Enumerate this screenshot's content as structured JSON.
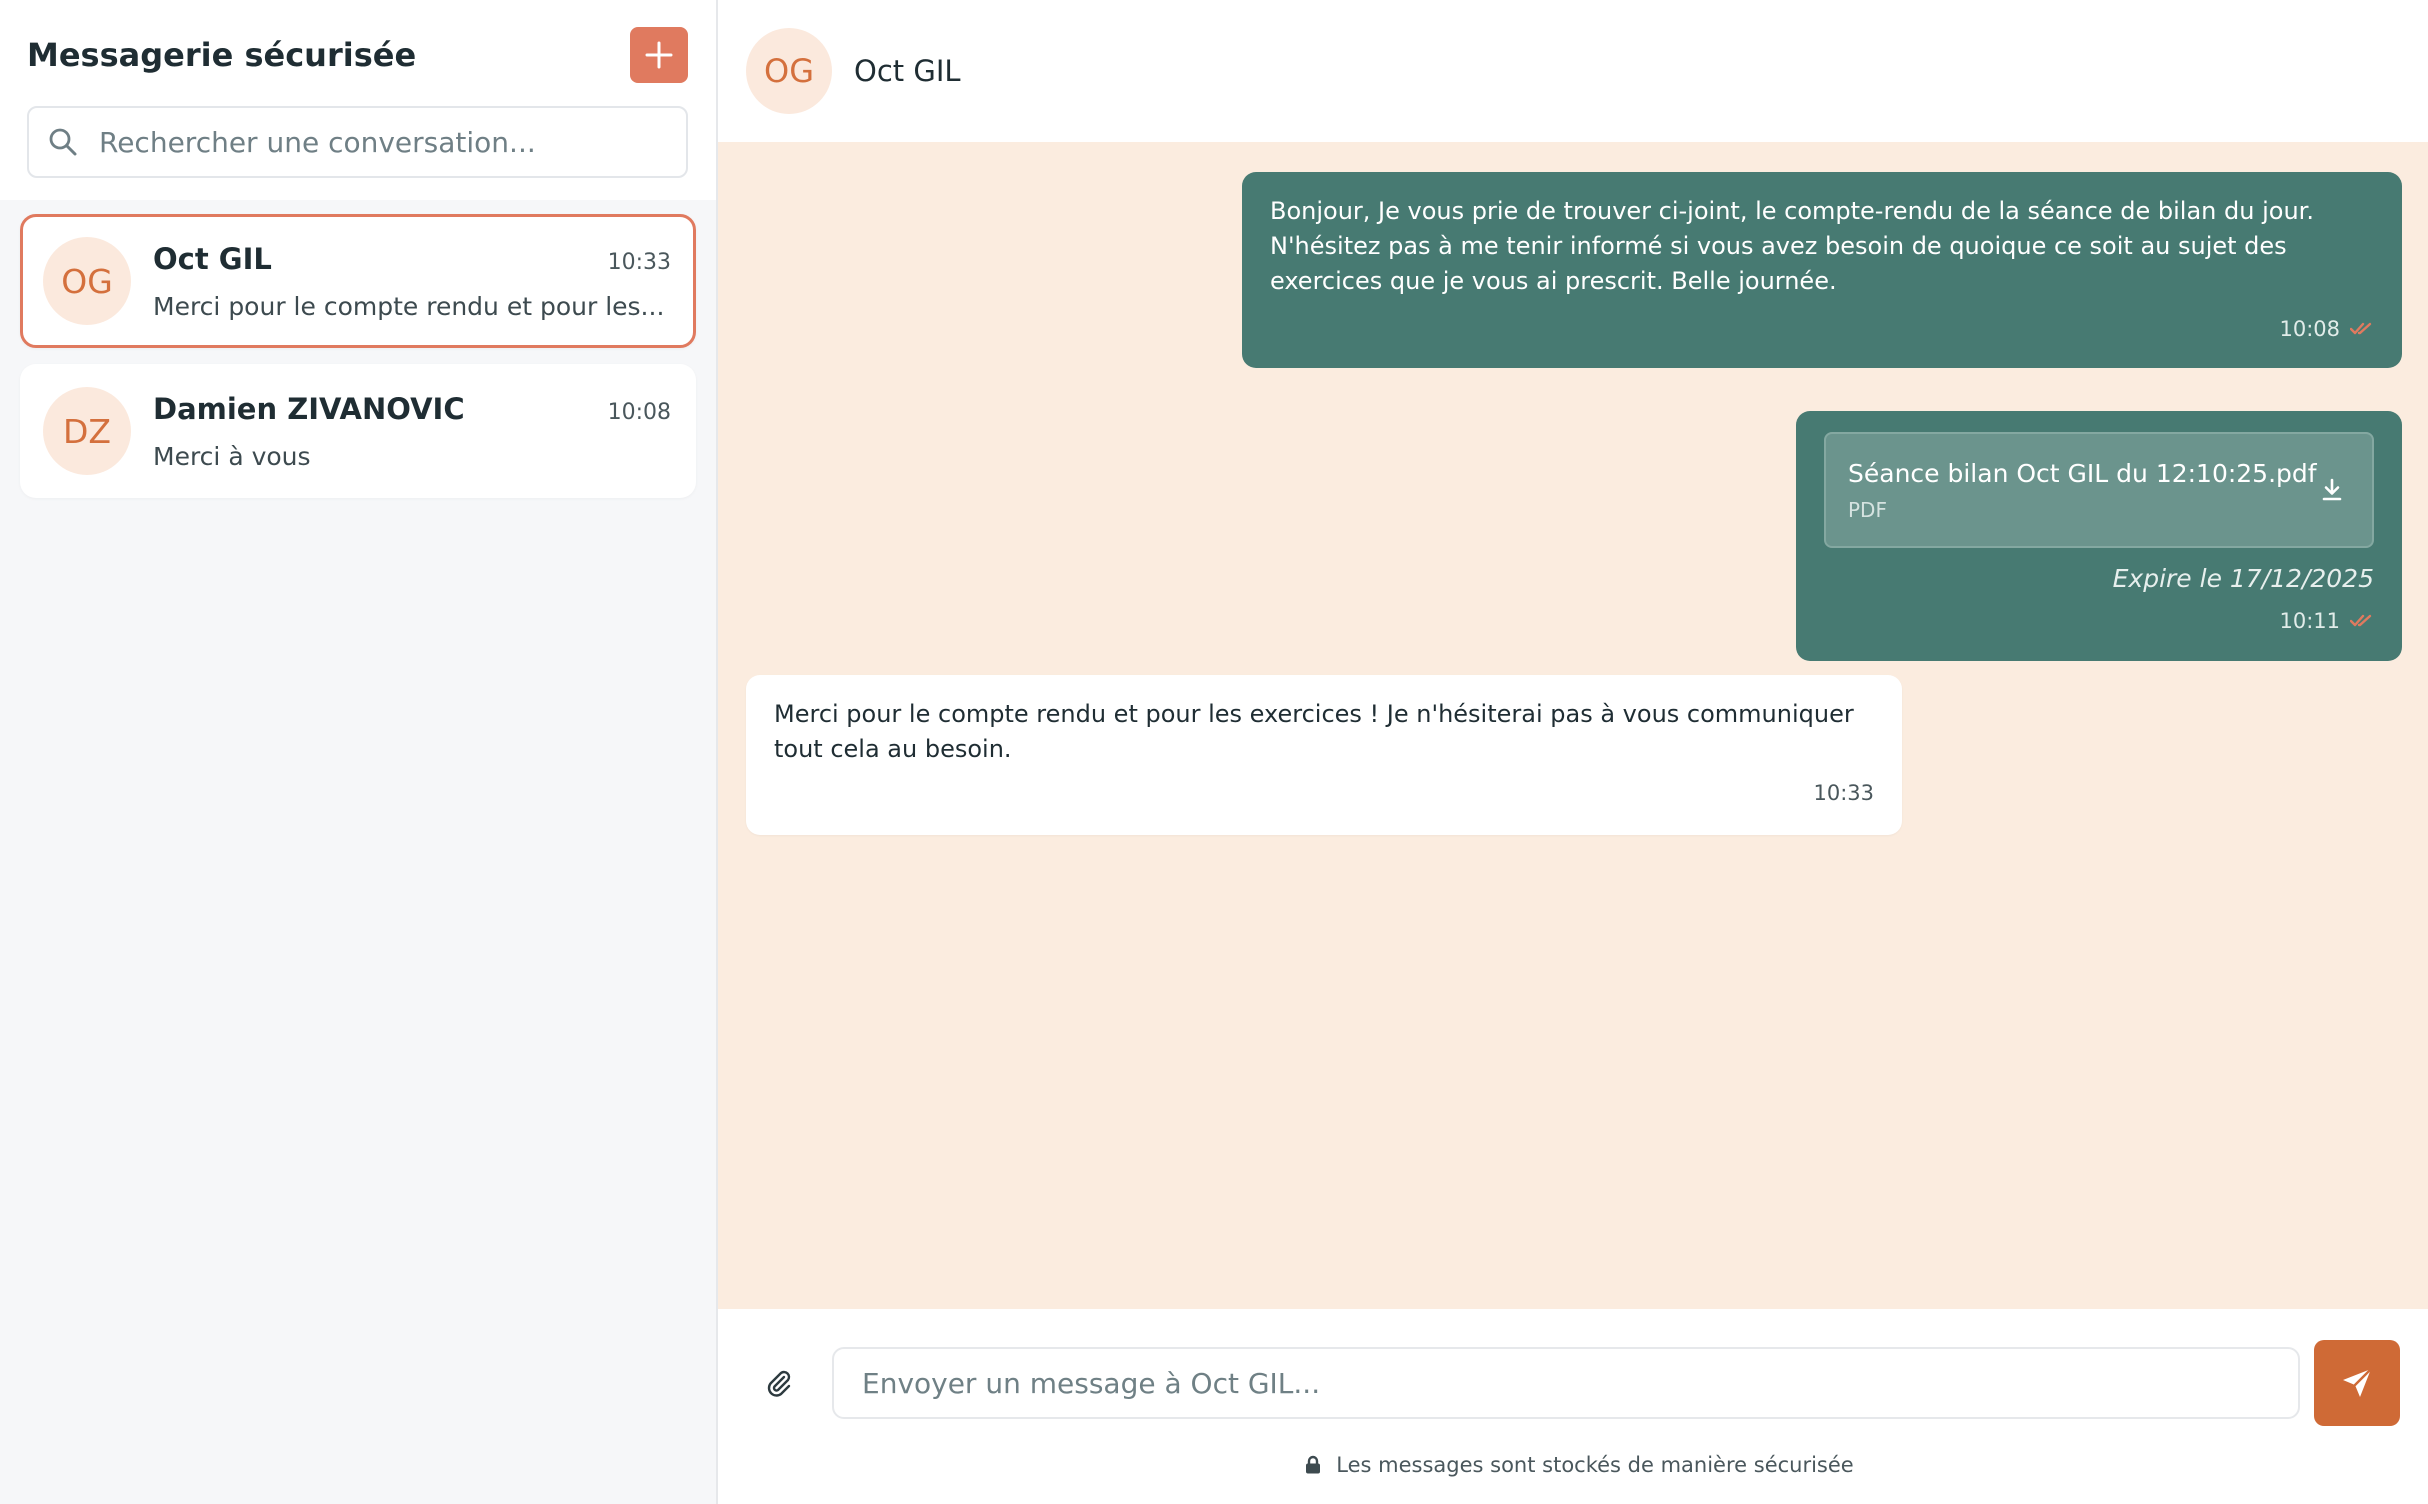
{
  "sidebar": {
    "title": "Messagerie sécurisée",
    "search_placeholder": "Rechercher une conversation...",
    "conversations": [
      {
        "initials": "OG",
        "name": "Oct GIL",
        "time": "10:33",
        "preview": "Merci pour le compte rendu et pour les...",
        "active": true
      },
      {
        "initials": "DZ",
        "name": "Damien ZIVANOVIC",
        "time": "10:08",
        "preview": "Merci à vous",
        "active": false
      }
    ]
  },
  "chat": {
    "contact_initials": "OG",
    "contact_name": "Oct GIL",
    "messages": [
      {
        "direction": "out",
        "text": "Bonjour, Je vous prie de trouver ci-joint, le compte-rendu de la séance de bilan du jour. N'hésitez pas à me tenir informé si vous avez besoin de quoique ce soit au sujet des exercices que je vous ai prescrit. Belle journée.",
        "time": "10:08",
        "read": true
      },
      {
        "direction": "out",
        "attachment": {
          "filename": "Séance bilan Oct GIL du 12:10:25.pdf",
          "type": "PDF"
        },
        "expiry": "Expire le 17/12/2025",
        "time": "10:11",
        "read": true
      },
      {
        "direction": "in",
        "text": "Merci pour le compte rendu et pour les exercices ! Je n'hésiterai pas à vous communiquer tout cela au besoin.",
        "time": "10:33"
      }
    ],
    "composer": {
      "placeholder": "Envoyer un message à Oct GIL...",
      "secure_note": "Les messages sont stockés de manière sécurisée"
    }
  },
  "colors": {
    "accent": "#e07a5f",
    "send_button": "#cf6a36",
    "outgoing_bubble": "#477a72",
    "chat_background": "#fbecdf",
    "read_check": "#e07a5f"
  },
  "icons": {
    "new_conversation": "plus-icon",
    "search": "search-icon",
    "read_receipt": "double-check-icon",
    "download": "download-icon",
    "attach": "paperclip-icon",
    "send": "send-icon",
    "lock": "lock-icon"
  }
}
